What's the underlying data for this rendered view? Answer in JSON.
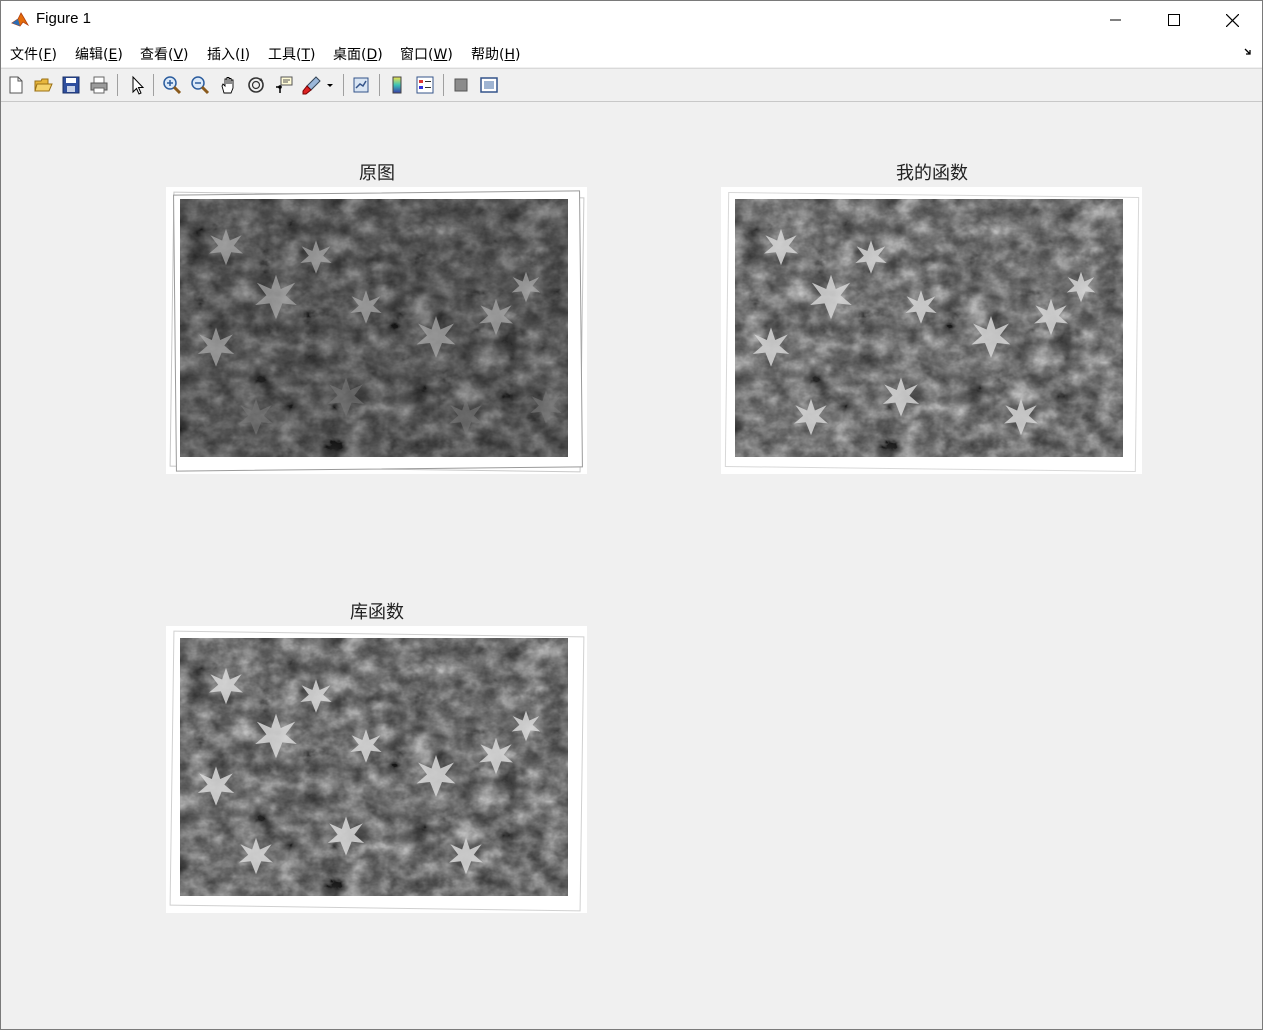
{
  "window": {
    "title": "Figure 1"
  },
  "menu": [
    {
      "label": "文件(",
      "mn": "F",
      "end": ")"
    },
    {
      "label": "编辑(",
      "mn": "E",
      "end": ")"
    },
    {
      "label": "查看(",
      "mn": "V",
      "end": ")"
    },
    {
      "label": "插入(",
      "mn": "I",
      "end": ")"
    },
    {
      "label": "工具(",
      "mn": "T",
      "end": ")"
    },
    {
      "label": "桌面(",
      "mn": "D",
      "end": ")"
    },
    {
      "label": "窗口(",
      "mn": "W",
      "end": ")"
    },
    {
      "label": "帮助(",
      "mn": "H",
      "end": ")"
    }
  ],
  "toolbar": {
    "buttons": [
      "new-figure-icon",
      "open-file-icon",
      "save-icon",
      "print-icon",
      "edit-plot-arrow-icon",
      "zoom-in-icon",
      "zoom-out-icon",
      "pan-hand-icon",
      "rotate-3d-icon",
      "data-cursor-icon",
      "brush-icon",
      "link-plot-icon",
      "colorbar-icon",
      "legend-icon",
      "hide-plot-tools-icon",
      "show-plot-tools-icon"
    ]
  },
  "subplots": [
    {
      "title": "原图",
      "brightness": "original"
    },
    {
      "title": "我的函数",
      "brightness": "enhanced"
    },
    {
      "title": "库函数",
      "brightness": "enhanced"
    }
  ],
  "colors": {
    "background": "#f0f0f0",
    "titlebar": "#ffffff",
    "accent": "#0072bd"
  }
}
